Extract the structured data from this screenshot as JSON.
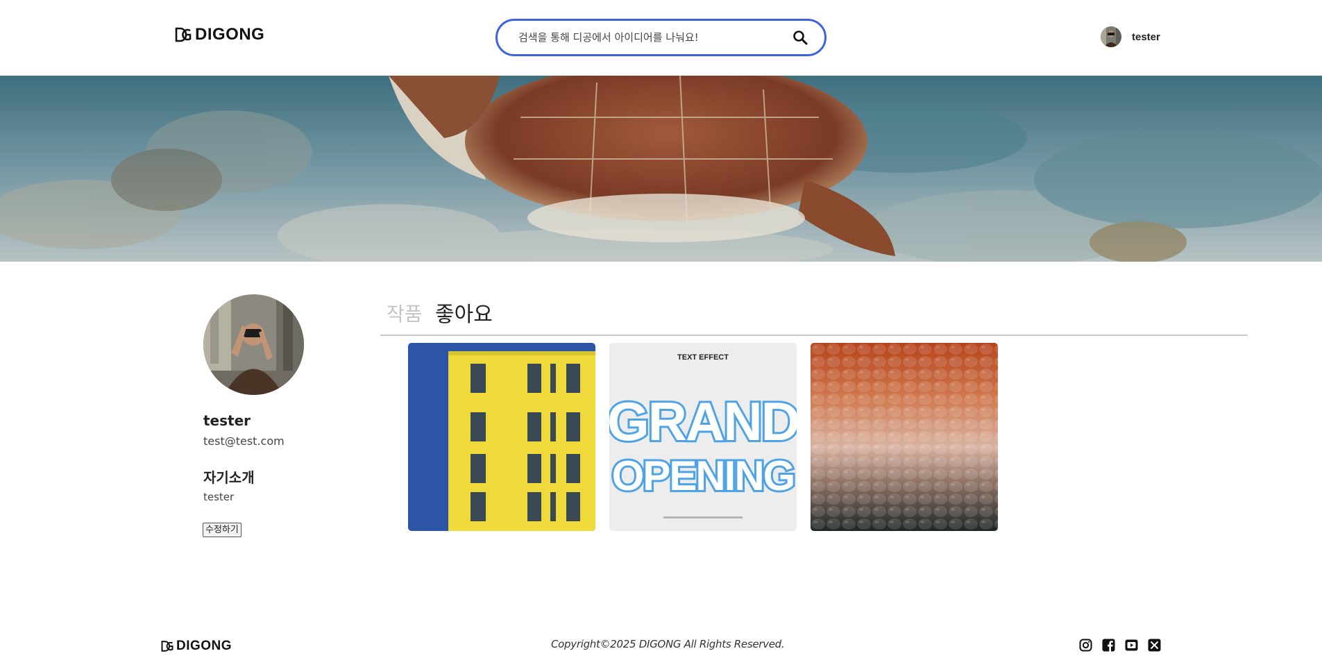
{
  "header": {
    "logo_text": "DIGONG",
    "search_placeholder": "검색을 통해 디공에서 아이디어를 나눠요!",
    "user_name": "tester"
  },
  "profile": {
    "name": "tester",
    "email": "test@test.com",
    "intro_heading": "자기소개",
    "intro_text": "tester",
    "edit_button": "수정하기"
  },
  "tabs": [
    {
      "label": "작품",
      "active": false
    },
    {
      "label": "좋아요",
      "active": true
    }
  ],
  "cards": [
    {
      "name": "yellow-building",
      "texts": []
    },
    {
      "name": "grand-opening",
      "texts": [
        "TEXT EFFECT",
        "GRAND",
        "OPENING"
      ]
    },
    {
      "name": "textured-glass",
      "texts": []
    }
  ],
  "footer": {
    "logo_text": "DIGONG",
    "copyright": "Copyright©2025 DIGONG All Rights Reserved.",
    "socials": [
      "instagram-icon",
      "facebook-icon",
      "youtube-icon",
      "x-icon"
    ]
  },
  "colors": {
    "search_border": "#3d63e0",
    "tab_inactive": "#c4c4c4",
    "divider": "#c9c9c9"
  }
}
